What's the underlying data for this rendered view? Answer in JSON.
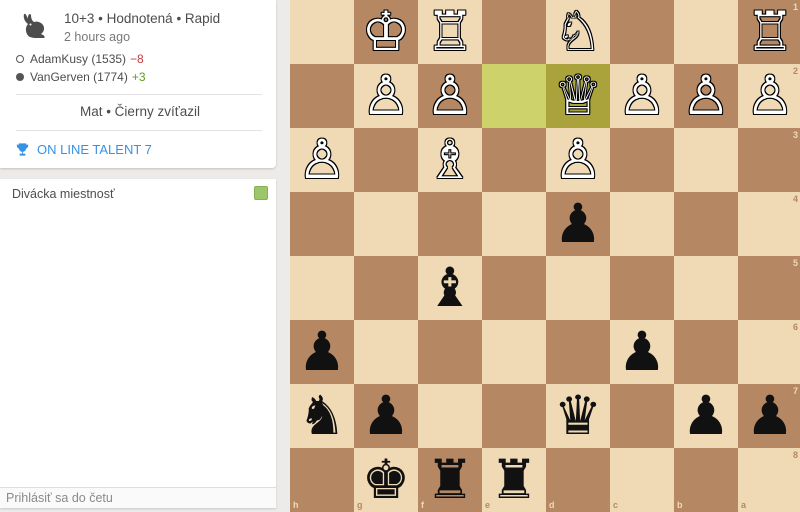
{
  "game": {
    "setup": "10+3 • Hodnotená • Rapid",
    "time_ago": "2 hours ago",
    "players": [
      {
        "color": "white",
        "name": "AdamKusy (1535)",
        "diff": "−8"
      },
      {
        "color": "black",
        "name": "VanGerven (1774)",
        "diff": "+3"
      }
    ],
    "result": "Mat • Čierny zvíťazil",
    "tournament": "ON LINE TALENT 7",
    "icon": "rabbit-icon",
    "tournament_icon": "trophy-icon"
  },
  "chat": {
    "title": "Divácka miestnosť",
    "placeholder": "Prihlásiť sa do četu"
  },
  "board": {
    "orientation": "black",
    "files": [
      "h",
      "g",
      "f",
      "e",
      "d",
      "c",
      "b",
      "a"
    ],
    "ranks": [
      "1",
      "2",
      "3",
      "4",
      "5",
      "6",
      "7",
      "8"
    ],
    "highlight": [
      "e2",
      "d2"
    ],
    "colors": {
      "light": "#f0d9b5",
      "dark": "#b58863",
      "highlight": "#cdd26a"
    },
    "pieces": [
      {
        "sq": "g1",
        "type": "king",
        "color": "white"
      },
      {
        "sq": "f1",
        "type": "rook",
        "color": "white"
      },
      {
        "sq": "d1",
        "type": "knight",
        "color": "white"
      },
      {
        "sq": "a1",
        "type": "rook",
        "color": "white"
      },
      {
        "sq": "g2",
        "type": "pawn",
        "color": "white"
      },
      {
        "sq": "f2",
        "type": "pawn",
        "color": "white"
      },
      {
        "sq": "d2",
        "type": "queen",
        "color": "white"
      },
      {
        "sq": "c2",
        "type": "pawn",
        "color": "white"
      },
      {
        "sq": "b2",
        "type": "pawn",
        "color": "white"
      },
      {
        "sq": "a2",
        "type": "pawn",
        "color": "white"
      },
      {
        "sq": "h3",
        "type": "pawn",
        "color": "white"
      },
      {
        "sq": "f3",
        "type": "bishop",
        "color": "white"
      },
      {
        "sq": "d3",
        "type": "pawn",
        "color": "white"
      },
      {
        "sq": "d4",
        "type": "pawn",
        "color": "black"
      },
      {
        "sq": "f5",
        "type": "bishop",
        "color": "black"
      },
      {
        "sq": "h6",
        "type": "pawn",
        "color": "black"
      },
      {
        "sq": "c6",
        "type": "pawn",
        "color": "black"
      },
      {
        "sq": "h7",
        "type": "knight",
        "color": "black"
      },
      {
        "sq": "g7",
        "type": "pawn",
        "color": "black"
      },
      {
        "sq": "d7",
        "type": "queen",
        "color": "black"
      },
      {
        "sq": "b7",
        "type": "pawn",
        "color": "black"
      },
      {
        "sq": "a7",
        "type": "pawn",
        "color": "black"
      },
      {
        "sq": "g8",
        "type": "king",
        "color": "black"
      },
      {
        "sq": "f8",
        "type": "rook",
        "color": "black"
      },
      {
        "sq": "e8",
        "type": "rook",
        "color": "black"
      }
    ]
  }
}
